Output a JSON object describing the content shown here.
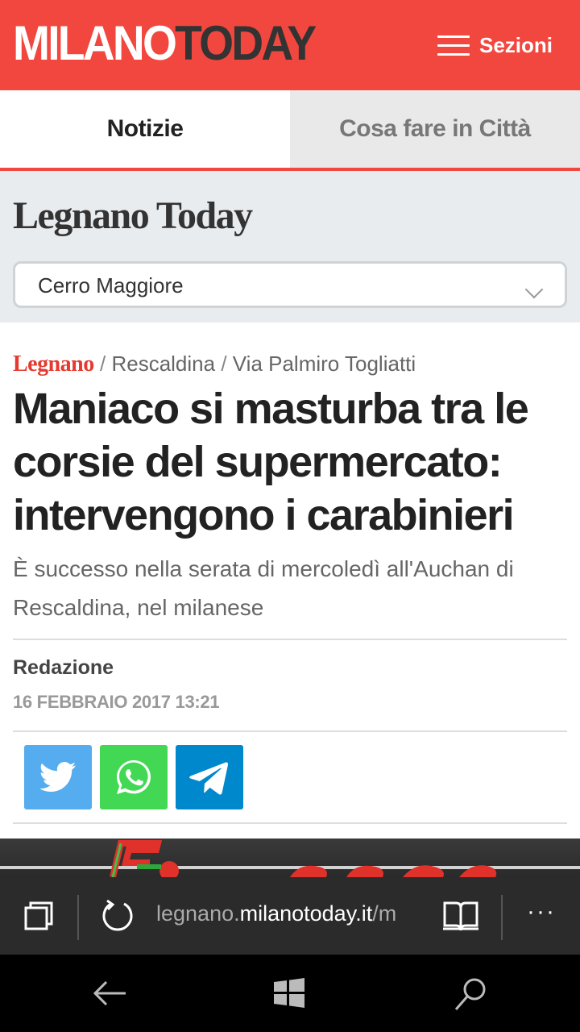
{
  "header": {
    "logo_part1": "MILANO",
    "logo_part2": "TODAY",
    "menu_label": "Sezioni"
  },
  "tabs": [
    {
      "label": "Notizie"
    },
    {
      "label": "Cosa fare in Città"
    }
  ],
  "local": {
    "title": "Legnano Today",
    "select_value": "Cerro Maggiore"
  },
  "article": {
    "breadcrumb": {
      "main": "Legnano",
      "items": [
        "Rescaldina",
        "Via Palmiro Togliatti"
      ],
      "separator": "/"
    },
    "headline": "Maniaco si masturba tra le corsie del supermercato: intervengono i carabinieri",
    "summary": "È successo nella serata di mercoledì all'Auchan di Rescaldina, nel milanese",
    "author": "Redazione",
    "date": "16 FEBBRAIO 2017 13:21"
  },
  "share": {
    "buttons": [
      "twitter-icon",
      "whatsapp-icon",
      "telegram-icon"
    ]
  },
  "browser": {
    "url_prefix": "legnano.",
    "url_host": "milanotoday.it",
    "url_suffix": "/m",
    "more_label": "···"
  },
  "colors": {
    "brand_red": "#f2473f",
    "twitter": "#55acee",
    "whatsapp": "#43d854",
    "telegram": "#0088cc"
  }
}
